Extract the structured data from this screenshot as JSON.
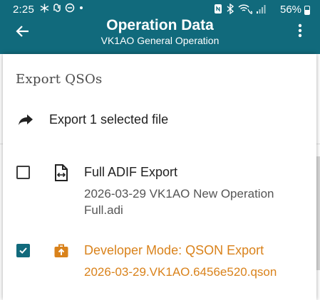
{
  "status_bar": {
    "time": "2:25",
    "battery": "56%"
  },
  "app_bar": {
    "title": "Operation Data",
    "subtitle": "VK1AO General Operation"
  },
  "dialog": {
    "heading": "Export QSOs",
    "export_action": "Export 1 selected file",
    "files": [
      {
        "title": "Full ADIF Export",
        "filename": "2026-03-29 VK1AO New Operation Full.adi",
        "checked": false,
        "icon": "file-export-icon"
      },
      {
        "title": "Developer Mode: QSON Export",
        "filename": "2026-03-29.VK1AO.6456e520.qson",
        "checked": true,
        "icon": "briefcase-upload-icon"
      }
    ]
  },
  "colors": {
    "app_bar": "#116a7c",
    "checkbox_checked": "#116a7c",
    "developer_accent": "#d9821b"
  }
}
